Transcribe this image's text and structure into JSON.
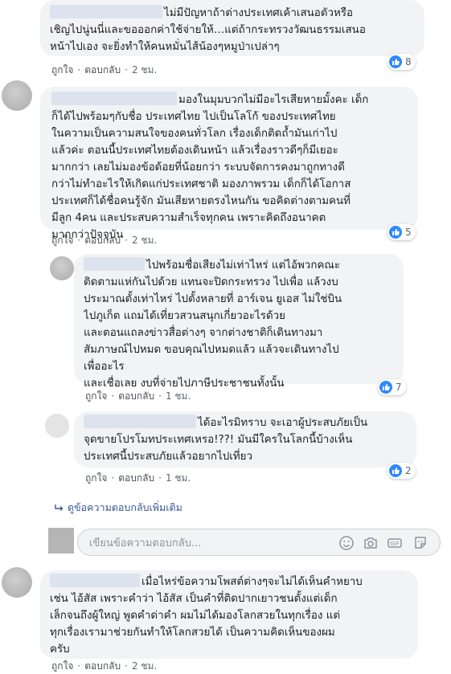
{
  "comments": [
    {
      "lines": [
        "ไม่มีปัญหาถ้าต่างประเทศเค้าเสนอตัวหรือ",
        "เชิญไปนู่นนี่และขอออกค่าใช้จ่ายให้…แต่ถ้ากระทรวงวัฒนธรรมเสนอ",
        "หน้าไปเอง จะยิ่งทำให้คนหมั่นไส้น้องๆหมูป่าเปล่าๆ"
      ],
      "like": "ถูกใจ",
      "reply": "ตอบกลับ",
      "time": "2 ชม.",
      "reactions": "8"
    },
    {
      "lines": [
        "มองในมุมบวกไม่มีอะไรเสียหายมั้งคะ เด็ก",
        "ก็ได้ไปพร้อมๆกับชื่อ ประเทศไทย ไปเป็นโลโก้ ของประเทศไทย",
        "ในความเป็นความสนใจของคนทั่วโลก เรื่องเด็กติดถ้ำมันเก่าไป",
        "แล้วค่ะ ตอนนี้ประเทศไทยต้องเดินหน้า แล้วเรื่องราวดีๆก็มีเยอะ",
        "มากกว่า เลยไม่มองข้อด้อยที่น้อยกว่า ระบบจัดการคงมาถูกทางดี",
        "กว่าไม่ทำอะไรให้เกิดแก่ประเทศชาติ มองภาพรวม เด็กก็ได้โอกาส",
        "ประเทศก็ได้ชื่อคนรู้จัก มันเสียหายตรงไหนกัน ขอคิดต่างตามคนที่",
        "มีลูก 4คน และประสบความสำเร็จทุกคน เพราะคิดถึงอนาคต",
        "มากกว่าปัจจุบัน"
      ],
      "like": "ถูกใจ",
      "reply": "ตอบกลับ",
      "time": "2 ชม.",
      "reactions": "5"
    },
    {
      "lines": [
        "ไปพร้อมชื่อเสียงไม่เท่าไหร่ แต่ไอ้พวกคณะ",
        "ติดตามแห่กันไปด้วย แทนจะปิดกระทรวง ไปเพื่อ แล้วงบ",
        "ประมาณตั้งเท่าไหร่ ไปตั้งหลายที่ อาร์เจน ยูเอส ไม่ใช่บิน",
        "ไปภูเก็ต แถมได้เที่ยวสวนสนุกเกี่ยวอะไรด้วย",
        "และตอนแถลงข่าวสื่อต่างๆ จากต่างชาติก็เดินทางมา",
        "สัมภาษณ์ไปหมด ขอบคุณไปหมดแล้ว แล้วจะเดินทางไป",
        "เพื่ออะไร",
        "และเชื่อเลย งบที่จ่ายไปภาษีประชาชนทั้งนั้น"
      ],
      "like": "ถูกใจ",
      "reply": "ตอบกลับ",
      "time": "1 ชม.",
      "reactions": "7"
    },
    {
      "lines": [
        "ได้อะไรมิทราบ จะเอาผู้ประสบภัยเป็น",
        "จุดขายโปรโมทประเทศเหรอ!??! มันมีใครในโลกนี้บ้างเห็น",
        "ประเทศนี้ประสบภัยแล้วอยากไปเที่ยว"
      ],
      "like": "ถูกใจ",
      "reply": "ตอบกลับ",
      "time": "1 ชม.",
      "reactions": "2"
    },
    {
      "lines": [
        "เมื่อไหร่ข้อความโพสต์ต่างๆจะไม่ได้เห็นคำหยาบ",
        "เช่น ไอ้สัส เพราะคำว่า ไอ้สัส เป็นคำที่ติดปากเยาวชนตั้งแต่เด็ก",
        "เล็กจนถึงผู้ใหญ่ พูดคำด่าคำ ผมไม่ได้มองโลกสวยในทุกเรื่อง แต่",
        "ทุกเรื่องเรามาช่วยกันทำให้โลกสวยได้ เป็นความคิดเห็นของผม",
        "ครับ"
      ],
      "like": "ถูกใจ",
      "reply": "ตอบกลับ",
      "time": "2 ชม.",
      "reactions": ""
    }
  ],
  "more_replies": "ดูข้อความตอบกลับเพิ่มเติม",
  "reply_box": {
    "placeholder": "เขียนข้อความตอบกลับ..."
  },
  "icons": [
    "like-icon",
    "reply-arrow-icon",
    "emoji-icon",
    "camera-icon",
    "gif-icon",
    "sticker-icon"
  ],
  "colors": {
    "bubble": "#f2f3f5",
    "like_blue": "#2e89ff",
    "link": "#385898",
    "meta": "#606770"
  }
}
